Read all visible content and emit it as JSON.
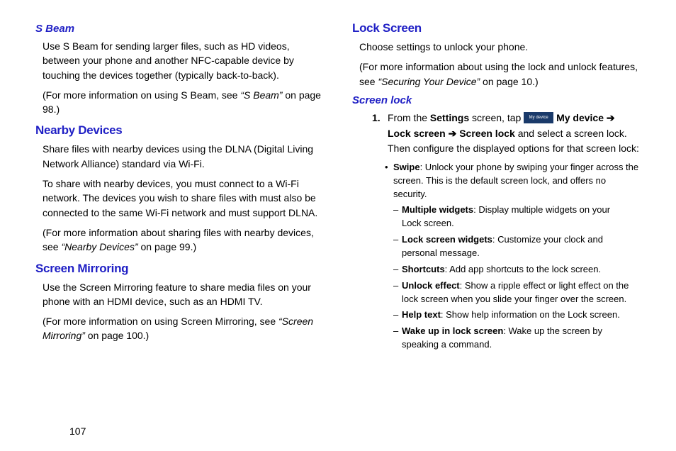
{
  "page_number": "107",
  "left": {
    "sbeam": {
      "heading": "S Beam",
      "p1": "Use S Beam for sending larger files, such as HD videos, between your phone and another NFC-capable device by touching the devices together (typically back-to-back).",
      "p2_a": "(For more information on using S Beam, see ",
      "p2_q": "“S Beam”",
      "p2_b": " on page 98.)"
    },
    "nearby": {
      "heading": "Nearby Devices",
      "p1": "Share files with nearby devices using the DLNA (Digital Living Network Alliance) standard via Wi-Fi.",
      "p2": "To share with nearby devices, you must connect to a Wi-Fi network. The devices you wish to share files with must also be connected to the same Wi-Fi network and must support DLNA.",
      "p3_a": "(For more information about sharing files with nearby devices, see ",
      "p3_q": "“Nearby Devices”",
      "p3_b": " on page 99.)"
    },
    "mirror": {
      "heading": "Screen Mirroring",
      "p1": "Use the Screen Mirroring feature to share media files on your phone with an HDMI device, such as an HDMI TV.",
      "p2_a": "(For more information on using Screen Mirroring, see ",
      "p2_q": "“Screen Mirroring”",
      "p2_b": " on page 100.)"
    }
  },
  "right": {
    "lock": {
      "heading": "Lock Screen",
      "p1": "Choose settings to unlock your phone.",
      "p2_a": "(For more information about using the lock and unlock features, see ",
      "p2_q": "“Securing Your Device”",
      "p2_b": " on page 10.)"
    },
    "screenlock": {
      "heading": "Screen lock",
      "step_num": "1.",
      "step_a": "From the ",
      "step_b_settings": "Settings",
      "step_c": " screen, tap ",
      "icon_label": "My device",
      "step_d_bold": " My device ➔ Lock screen ➔ Screen lock",
      "step_e": " and select a screen lock. Then configure the displayed options for that screen lock:",
      "swipe_b": "Swipe",
      "swipe_t": ": Unlock your phone by swiping your finger across the screen. This is the default screen lock, and offers no security.",
      "mw_b": "Multiple widgets",
      "mw_t": ": Display multiple widgets on your Lock screen.",
      "lsw_b": "Lock screen widgets",
      "lsw_t": ": Customize your clock and personal message.",
      "sc_b": "Shortcuts",
      "sc_t": ": Add app shortcuts to the lock screen.",
      "ue_b": "Unlock effect",
      "ue_t": ": Show a ripple effect or light effect on the lock screen when you slide your finger over the screen.",
      "ht_b": "Help text",
      "ht_t": ": Show help information on the Lock screen.",
      "wu_b": "Wake up in lock screen",
      "wu_t": ": Wake up the screen by speaking a command."
    }
  }
}
